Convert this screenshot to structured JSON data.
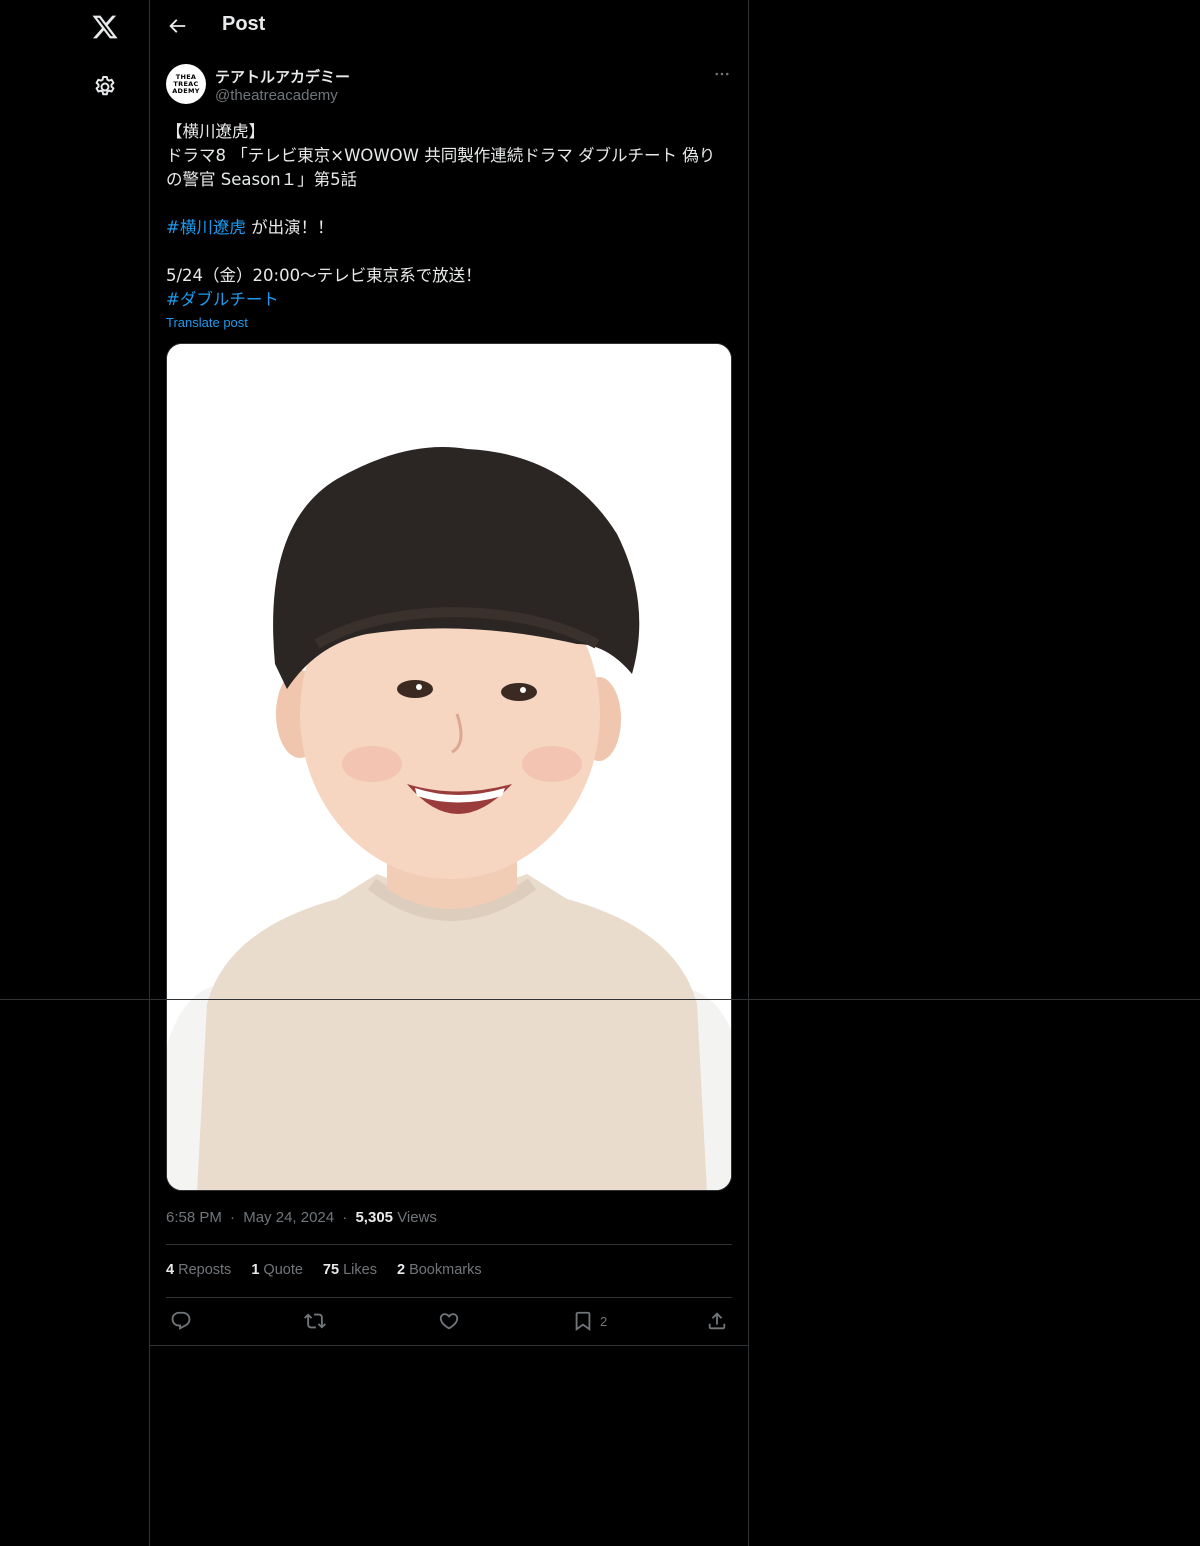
{
  "nav": {
    "logo_icon": "x-logo-icon",
    "settings_icon": "gear-icon"
  },
  "header": {
    "title": "Post",
    "back_icon": "arrow-left-icon"
  },
  "author": {
    "display_name": "テアトルアカデミー",
    "handle": "@theatreacademy",
    "avatar_lines": [
      "THEA",
      "TREAC",
      "ADEMY"
    ]
  },
  "post": {
    "lines": [
      [
        {
          "t": "【横川遼虎】",
          "tag": false
        }
      ],
      [
        {
          "t": "ドラマ8 「テレビ東京×WOWOW 共同製作連続ドラマ ダブルチート 偽り",
          "tag": false
        }
      ],
      [
        {
          "t": "の警官 Season１」第5話",
          "tag": false
        }
      ],
      [],
      [
        {
          "t": "#横川遼虎",
          "tag": true
        },
        {
          "t": " が出演！！",
          "tag": false
        }
      ],
      [],
      [
        {
          "t": "5/24（金）20:00〜テレビ東京系で放送！",
          "tag": false
        }
      ],
      [
        {
          "t": "#ダブルチート",
          "tag": true
        }
      ]
    ],
    "translate_label": "Translate post",
    "media_alt": "photo"
  },
  "meta": {
    "time": "6:58 PM",
    "date": "May 24, 2024",
    "views_count": "5,305",
    "views_label": "Views",
    "separator": "·"
  },
  "stats": {
    "reposts_count": "4",
    "reposts_label": "Reposts",
    "quotes_count": "1",
    "quotes_label": "Quote",
    "likes_count": "75",
    "likes_label": "Likes",
    "bookmarks_count": "2",
    "bookmarks_label": "Bookmarks"
  },
  "actions": {
    "reply_icon": "reply-icon",
    "repost_icon": "repost-icon",
    "like_icon": "heart-icon",
    "bookmark_icon": "bookmark-icon",
    "bookmark_count": "2",
    "share_icon": "share-icon"
  },
  "colors": {
    "background": "#000000",
    "text": "#e7e9ea",
    "muted": "#71767b",
    "accent": "#1d9bf0",
    "border": "#2f3336"
  }
}
